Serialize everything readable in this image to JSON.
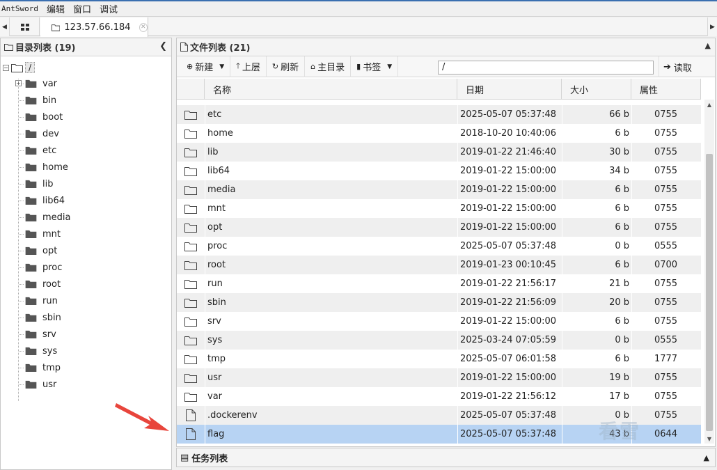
{
  "menubar": {
    "app_name": "AntSword",
    "items": [
      "编辑",
      "窗口",
      "调试"
    ]
  },
  "tabs": {
    "active_label": "123.57.66.184"
  },
  "dir_panel": {
    "title": "目录列表 (19)",
    "root_label": "/",
    "items": [
      "var",
      "bin",
      "boot",
      "dev",
      "etc",
      "home",
      "lib",
      "lib64",
      "media",
      "mnt",
      "opt",
      "proc",
      "root",
      "run",
      "sbin",
      "srv",
      "sys",
      "tmp",
      "usr"
    ]
  },
  "file_panel": {
    "title": "文件列表 (21)",
    "toolbar": {
      "new": "新建",
      "up": "上层",
      "refresh": "刷新",
      "home": "主目录",
      "bookmark": "书签",
      "path": "/",
      "read": "读取"
    },
    "columns": {
      "name": "名称",
      "date": "日期",
      "size": "大小",
      "perm": "属性"
    },
    "rows": [
      {
        "type": "folder",
        "name": "etc",
        "date": "2025-05-07 05:37:48",
        "size": "66 b",
        "perm": "0755"
      },
      {
        "type": "folder",
        "name": "home",
        "date": "2018-10-20 10:40:06",
        "size": "6 b",
        "perm": "0755"
      },
      {
        "type": "folder",
        "name": "lib",
        "date": "2019-01-22 21:46:40",
        "size": "30 b",
        "perm": "0755"
      },
      {
        "type": "folder",
        "name": "lib64",
        "date": "2019-01-22 15:00:00",
        "size": "34 b",
        "perm": "0755"
      },
      {
        "type": "folder",
        "name": "media",
        "date": "2019-01-22 15:00:00",
        "size": "6 b",
        "perm": "0755"
      },
      {
        "type": "folder",
        "name": "mnt",
        "date": "2019-01-22 15:00:00",
        "size": "6 b",
        "perm": "0755"
      },
      {
        "type": "folder",
        "name": "opt",
        "date": "2019-01-22 15:00:00",
        "size": "6 b",
        "perm": "0755"
      },
      {
        "type": "folder",
        "name": "proc",
        "date": "2025-05-07 05:37:48",
        "size": "0 b",
        "perm": "0555"
      },
      {
        "type": "folder",
        "name": "root",
        "date": "2019-01-23 00:10:45",
        "size": "6 b",
        "perm": "0700"
      },
      {
        "type": "folder",
        "name": "run",
        "date": "2019-01-22 21:56:17",
        "size": "21 b",
        "perm": "0755"
      },
      {
        "type": "folder",
        "name": "sbin",
        "date": "2019-01-22 21:56:09",
        "size": "20 b",
        "perm": "0755"
      },
      {
        "type": "folder",
        "name": "srv",
        "date": "2019-01-22 15:00:00",
        "size": "6 b",
        "perm": "0755"
      },
      {
        "type": "folder",
        "name": "sys",
        "date": "2025-03-24 07:05:59",
        "size": "0 b",
        "perm": "0555"
      },
      {
        "type": "folder",
        "name": "tmp",
        "date": "2025-05-07 06:01:58",
        "size": "6 b",
        "perm": "1777"
      },
      {
        "type": "folder",
        "name": "usr",
        "date": "2019-01-22 15:00:00",
        "size": "19 b",
        "perm": "0755"
      },
      {
        "type": "folder",
        "name": "var",
        "date": "2019-01-22 21:56:12",
        "size": "17 b",
        "perm": "0755"
      },
      {
        "type": "file",
        "name": ".dockerenv",
        "date": "2025-05-07 05:37:48",
        "size": "0 b",
        "perm": "0755"
      },
      {
        "type": "file",
        "name": "flag",
        "date": "2025-05-07 05:37:48",
        "size": "43 b",
        "perm": "0644",
        "selected": true
      }
    ]
  },
  "task_panel": {
    "title": "任务列表"
  },
  "watermark": "看雪",
  "colors": {
    "selected_row": "#b7d3f3",
    "alt_row": "#efefef",
    "annotation_arrow": "#e8453c"
  }
}
